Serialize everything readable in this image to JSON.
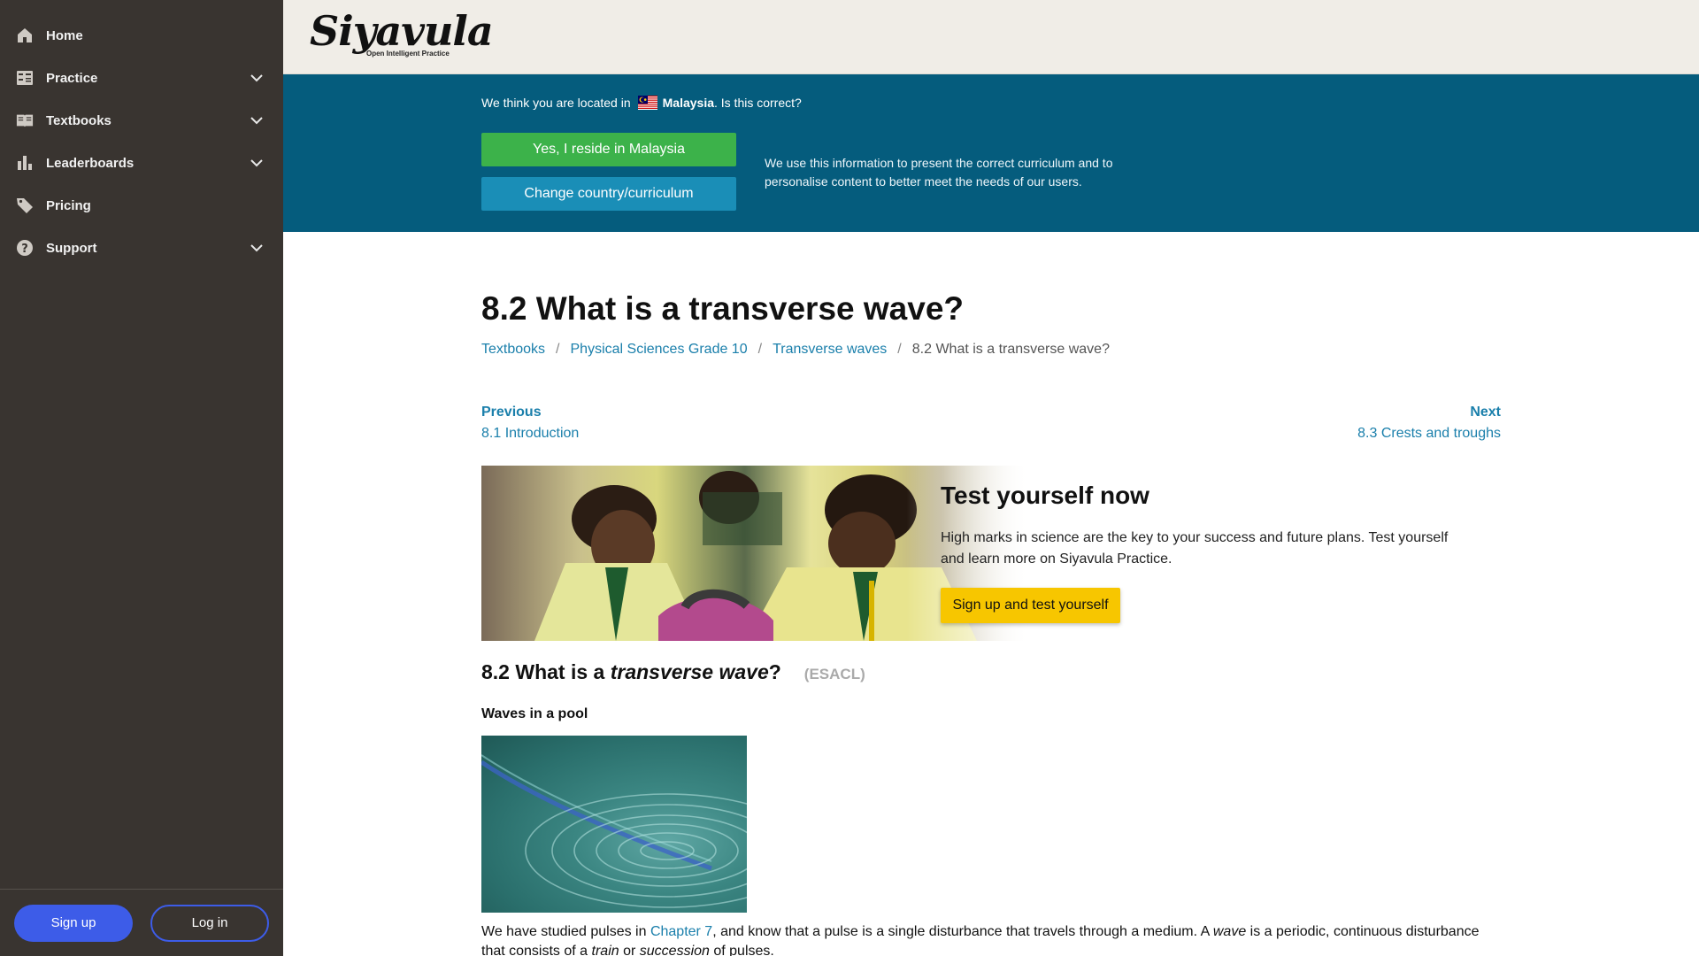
{
  "sidebar": {
    "items": [
      {
        "label": "Home",
        "icon": "home-icon",
        "has_dropdown": false
      },
      {
        "label": "Practice",
        "icon": "practice-icon",
        "has_dropdown": true
      },
      {
        "label": "Textbooks",
        "icon": "book-icon",
        "has_dropdown": true
      },
      {
        "label": "Leaderboards",
        "icon": "bar-chart-icon",
        "has_dropdown": true
      },
      {
        "label": "Pricing",
        "icon": "tag-icon",
        "has_dropdown": false
      },
      {
        "label": "Support",
        "icon": "help-icon",
        "has_dropdown": true
      }
    ],
    "signup_label": "Sign up",
    "login_label": "Log in"
  },
  "header": {
    "logo_text": "Siyavula",
    "logo_tagline": "Open Intelligent Practice"
  },
  "location": {
    "prefix": "We think you are located in",
    "country": "Malaysia",
    "suffix": ". Is this correct?",
    "yes_label": "Yes, I reside in Malaysia",
    "change_label": "Change country/curriculum",
    "info": "We use this information to present the correct curriculum and to personalise content to better meet the needs of our users."
  },
  "page": {
    "title": "8.2 What is a transverse wave?",
    "breadcrumb": [
      "Textbooks",
      "Physical Sciences Grade 10",
      "Transverse waves",
      "8.2 What is a transverse wave?"
    ],
    "previous_caption": "Previous",
    "previous_link": "8.1 Introduction",
    "next_caption": "Next",
    "next_link": "8.3 Crests and troughs"
  },
  "promo": {
    "title": "Test yourself now",
    "text": "High marks in science are the key to your success and future plans. Test yourself and learn more on Siyavula Practice.",
    "button_label": "Sign up and test yourself"
  },
  "section": {
    "heading_prefix": "8.2 What is a ",
    "heading_em": "transverse wave",
    "heading_suffix": "?",
    "id": "(ESACL)",
    "figure_title": "Waves in a pool",
    "body_1": "We have studied pulses in ",
    "body_link": "Chapter 7",
    "body_2": ", and know that a pulse is a single disturbance that travels through a medium. A ",
    "body_em1": "wave",
    "body_3": " is a periodic, continuous disturbance that consists of a ",
    "body_em2": "train",
    "body_4": " or ",
    "body_em3": "succession",
    "body_5": " of pulses."
  },
  "colors": {
    "sidebar_bg": "#393430",
    "header_bg": "#f0ede7",
    "banner_bg": "#055c7d",
    "yes_button": "#3cb24a",
    "change_button": "#1a8eb7",
    "link": "#1a7fab",
    "signup_button": "#3d5ce8",
    "promo_button": "#f7c600"
  }
}
